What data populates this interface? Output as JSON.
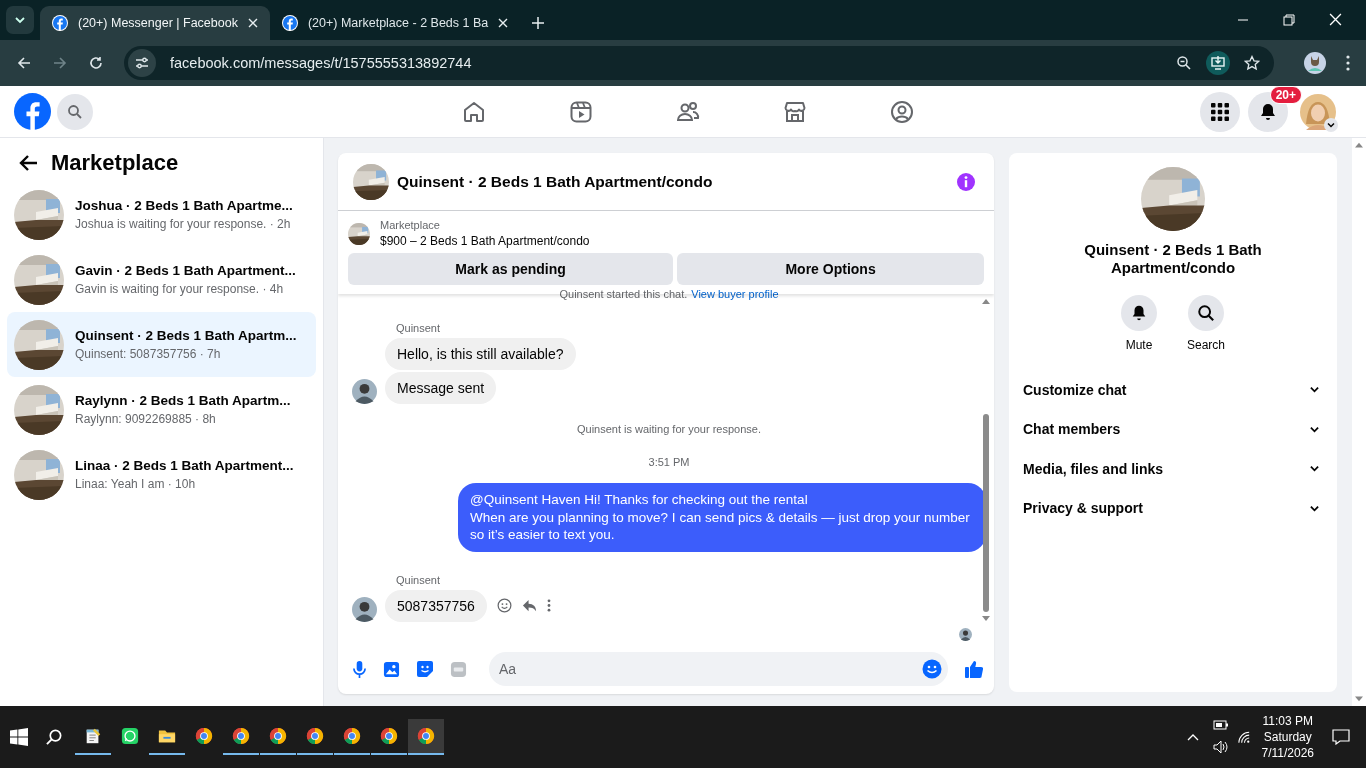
{
  "browser": {
    "tabs": [
      {
        "title": "(20+) Messenger | Facebook",
        "selected": true
      },
      {
        "title": "(20+) Marketplace - 2 Beds 1 Ba",
        "selected": false
      }
    ],
    "url": "facebook.com/messages/t/1575555313892744"
  },
  "topbar": {
    "notification_badge": "20+"
  },
  "sidebar": {
    "title": "Marketplace",
    "conversations": [
      {
        "title": "Joshua · 2 Beds 1 Bath Apartme...",
        "preview": "Joshua is waiting for your response. · 2h",
        "selected": false
      },
      {
        "title": "Gavin · 2 Beds 1 Bath Apartment...",
        "preview": "Gavin is waiting for your response. · 4h",
        "selected": false
      },
      {
        "title": "Quinsent · 2 Beds 1 Bath Apartm...",
        "preview": "Quinsent: 5087357756 · 7h",
        "selected": true
      },
      {
        "title": "Raylynn · 2 Beds 1 Bath Apartm...",
        "preview": "Raylynn: 9092269885 · 8h",
        "selected": false
      },
      {
        "title": "Linaa · 2 Beds 1 Bath Apartment...",
        "preview": "Linaa: Yeah I am · 10h",
        "selected": false
      }
    ]
  },
  "chat": {
    "title": "Quinsent · 2 Beds 1 Bath Apartment/condo",
    "listing": {
      "label": "Marketplace",
      "title": "$900 – 2 Beds 1 Bath Apartment/condo"
    },
    "buttons": [
      "Mark as pending",
      "More Options"
    ],
    "started_note": "Quinsent started this chat.",
    "buyer_link": "View buyer profile",
    "messages": [
      {
        "kind": "sender",
        "text": "Quinsent"
      },
      {
        "kind": "incoming",
        "text": "Hello, is this still available?",
        "avatar": false,
        "actions": false
      },
      {
        "kind": "incoming",
        "text": "Message sent",
        "avatar": true,
        "actions": false
      },
      {
        "kind": "status",
        "text": "Quinsent is waiting for your response."
      },
      {
        "kind": "time",
        "text": "3:51 PM"
      },
      {
        "kind": "outgoing",
        "text": "@Quinsent Haven Hi! Thanks for checking out the rental\nWhen are you planning to move? I can send pics & details — just drop your number so it’s easier to text you."
      },
      {
        "kind": "sender",
        "text": "Quinsent"
      },
      {
        "kind": "incoming",
        "text": "5087357756",
        "avatar": true,
        "actions": true
      }
    ],
    "composer": {
      "placeholder": "Aa"
    }
  },
  "details": {
    "title": "Quinsent · 2 Beds 1 Bath Apartment/condo",
    "actions": [
      {
        "kind": "mute",
        "label": "Mute"
      },
      {
        "kind": "search",
        "label": "Search"
      }
    ],
    "sections": [
      {
        "label": "Customize chat",
        "expanded": false
      },
      {
        "label": "Chat members",
        "expanded": false
      },
      {
        "label": "Media, files and links",
        "expanded": false
      },
      {
        "label": "Privacy & support",
        "expanded": false
      }
    ]
  },
  "taskbar": {
    "apps": [
      {
        "kind": "notepad",
        "running": true,
        "selected": false
      },
      {
        "kind": "whatsapp",
        "running": false,
        "selected": false
      },
      {
        "kind": "explorer",
        "running": true,
        "selected": false
      },
      {
        "kind": "chrome",
        "running": false,
        "selected": false
      },
      {
        "kind": "chrome",
        "running": true,
        "selected": false
      },
      {
        "kind": "chrome",
        "running": true,
        "selected": false
      },
      {
        "kind": "chrome",
        "running": true,
        "selected": false
      },
      {
        "kind": "chrome",
        "running": true,
        "selected": false
      },
      {
        "kind": "chrome",
        "running": true,
        "selected": false
      },
      {
        "kind": "chrome",
        "running": true,
        "selected": true
      }
    ],
    "time": "11:03 PM",
    "day": "Saturday",
    "date": "7/11/2026"
  }
}
